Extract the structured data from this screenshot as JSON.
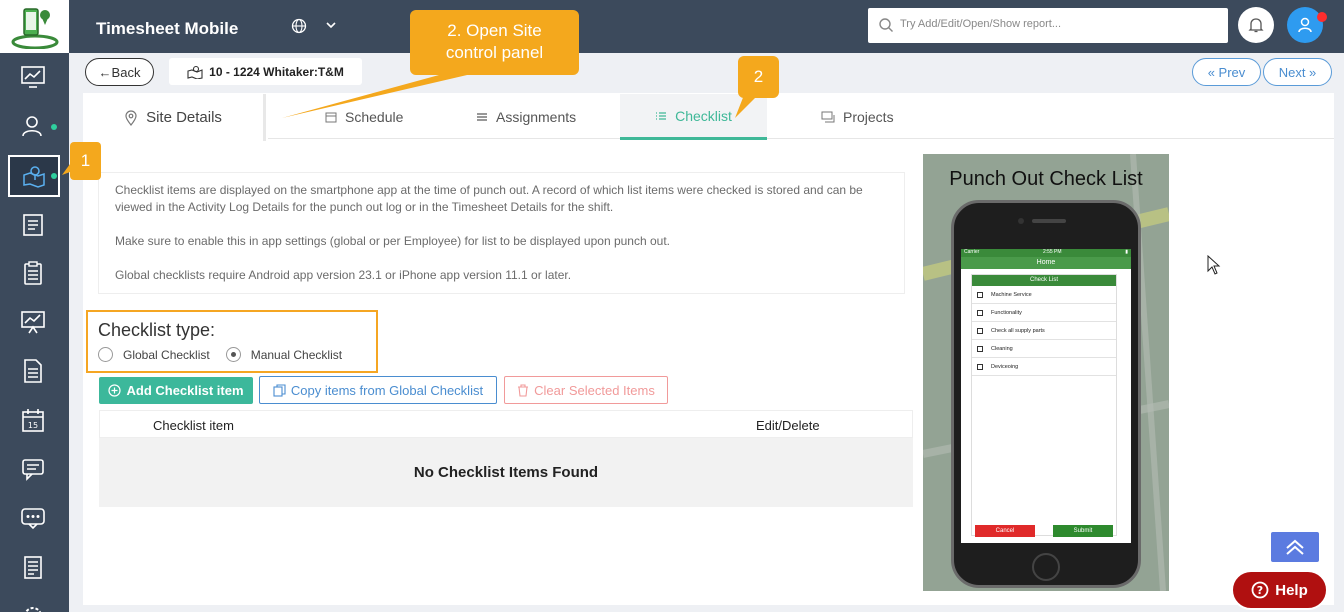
{
  "app": {
    "title": "Timesheet Mobile"
  },
  "search": {
    "placeholder": "Try Add/Edit/Open/Show report..."
  },
  "header": {
    "back_label": "Back",
    "site_name": "10 - 1224 Whitaker:T&M",
    "prev_label": "Prev",
    "next_label": "Next"
  },
  "tabs": [
    {
      "label": "Site Details",
      "icon": "map-pin-icon"
    },
    {
      "label": "Schedule",
      "icon": "calendar-icon"
    },
    {
      "label": "Assignments",
      "icon": "list-icon"
    },
    {
      "label": "Checklist",
      "icon": "checklist-icon",
      "active": true
    },
    {
      "label": "Projects",
      "icon": "projects-icon"
    }
  ],
  "info": {
    "p1": "Checklist items are displayed on the smartphone app at the time of punch out. A record of which list items were checked is stored and can be viewed in the Activity Log Details for the punch out log or in the Timesheet Details for the shift.",
    "p2": "Make sure to enable this in app settings (global or per Employee) for list to be displayed upon punch out.",
    "p3": "Global checklists require Android app version 23.1 or iPhone app version 11.1 or later."
  },
  "checklist_type": {
    "title": "Checklist type:",
    "options": [
      {
        "label": "Global Checklist",
        "selected": false
      },
      {
        "label": "Manual Checklist",
        "selected": true
      }
    ]
  },
  "actions": {
    "add": "Add Checklist item",
    "copy": "Copy items from Global Checklist",
    "clear": "Clear Selected Items"
  },
  "table": {
    "col_item": "Checklist item",
    "col_edit": "Edit/Delete",
    "empty": "No Checklist Items Found"
  },
  "preview": {
    "title": "Punch Out Check List",
    "status_left": "Carrier",
    "status_time": "2:55 PM",
    "nav_title": "Home",
    "list_title": "Check List",
    "items": [
      "Machine Service",
      "Functionality",
      "Check all supply parts",
      "Cleaning",
      "Deviceoing"
    ],
    "cancel": "Cancel",
    "submit": "Submit"
  },
  "callouts": {
    "big": "2. Open Site control panel",
    "two": "2",
    "one": "1"
  },
  "help": {
    "label": "Help"
  },
  "colors": {
    "sidebar": "#3c4a5c",
    "accent_green": "#3cb89b",
    "accent_blue": "#4a8dd0",
    "callout": "#f4a81d",
    "help": "#b01010"
  }
}
